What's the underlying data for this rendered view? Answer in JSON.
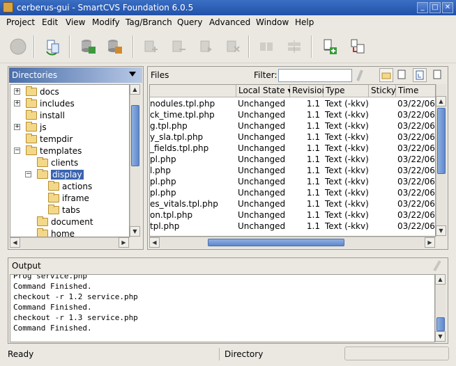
{
  "window": {
    "title": "cerberus-gui - SmartCVS Foundation 6.0.5"
  },
  "menu": [
    {
      "label": "Project"
    },
    {
      "label": "Edit"
    },
    {
      "label": "View"
    },
    {
      "label": "Modify"
    },
    {
      "label": "Tag/Branch"
    },
    {
      "label": "Query"
    },
    {
      "label": "Advanced"
    },
    {
      "label": "Window"
    },
    {
      "label": "Help"
    }
  ],
  "directories": {
    "title": "Directories",
    "items": [
      {
        "label": "docs",
        "expander": "+"
      },
      {
        "label": "includes",
        "expander": "+"
      },
      {
        "label": "install",
        "expander": ""
      },
      {
        "label": "js",
        "expander": "+"
      },
      {
        "label": "tempdir",
        "expander": ""
      },
      {
        "label": "templates",
        "expander": "−"
      },
      {
        "label": "clients",
        "expander": ""
      },
      {
        "label": "display",
        "expander": "−"
      },
      {
        "label": "actions",
        "expander": ""
      },
      {
        "label": "iframe",
        "expander": ""
      },
      {
        "label": "tabs",
        "expander": ""
      },
      {
        "label": "document",
        "expander": ""
      },
      {
        "label": "home",
        "expander": ""
      }
    ]
  },
  "files": {
    "title": "Files",
    "filter_label": "Filter:",
    "filter_value": "",
    "columns": [
      "Local State ▾",
      "Revision",
      "Type",
      "Sticky",
      "Time"
    ],
    "rows": [
      {
        "name": "nodules.tpl.php",
        "state": "Unchanged",
        "rev": "1.1",
        "type": "Text (-kkv)",
        "sticky": "",
        "time": "03/22/06"
      },
      {
        "name": "ck_time.tpl.php",
        "state": "Unchanged",
        "rev": "1.1",
        "type": "Text (-kkv)",
        "sticky": "",
        "time": "03/22/06"
      },
      {
        "name": "g.tpl.php",
        "state": "Unchanged",
        "rev": "1.1",
        "type": "Text (-kkv)",
        "sticky": "",
        "time": "03/22/06"
      },
      {
        "name": "y_sla.tpl.php",
        "state": "Unchanged",
        "rev": "1.1",
        "type": "Text (-kkv)",
        "sticky": "",
        "time": "03/22/06"
      },
      {
        "name": "_fields.tpl.php",
        "state": "Unchanged",
        "rev": "1.1",
        "type": "Text (-kkv)",
        "sticky": "",
        "time": "03/22/06"
      },
      {
        "name": "pl.php",
        "state": "Unchanged",
        "rev": "1.1",
        "type": "Text (-kkv)",
        "sticky": "",
        "time": "03/22/06"
      },
      {
        "name": "l.php",
        "state": "Unchanged",
        "rev": "1.1",
        "type": "Text (-kkv)",
        "sticky": "",
        "time": "03/22/06"
      },
      {
        "name": "pl.php",
        "state": "Unchanged",
        "rev": "1.1",
        "type": "Text (-kkv)",
        "sticky": "",
        "time": "03/22/06"
      },
      {
        "name": "pl.php",
        "state": "Unchanged",
        "rev": "1.1",
        "type": "Text (-kkv)",
        "sticky": "",
        "time": "03/22/06"
      },
      {
        "name": "es_vitals.tpl.php",
        "state": "Unchanged",
        "rev": "1.1",
        "type": "Text (-kkv)",
        "sticky": "",
        "time": "03/22/06"
      },
      {
        "name": "on.tpl.php",
        "state": "Unchanged",
        "rev": "1.1",
        "type": "Text (-kkv)",
        "sticky": "",
        "time": "03/22/06"
      },
      {
        "name": "tpl.php",
        "state": "Unchanged",
        "rev": "1.1",
        "type": "Text (-kkv)",
        "sticky": "",
        "time": "03/22/06"
      }
    ]
  },
  "output": {
    "title": "Output",
    "lines": [
      "Prog service.php",
      "Command Finished.",
      "checkout -r 1.2 service.php",
      "Command Finished.",
      "checkout -r 1.3 service.php",
      "Command Finished."
    ]
  },
  "status": {
    "left": "Ready",
    "middle": "Directory"
  },
  "colors": {
    "selection": "#3a63b0",
    "titlebar": "#2f5fb8"
  }
}
